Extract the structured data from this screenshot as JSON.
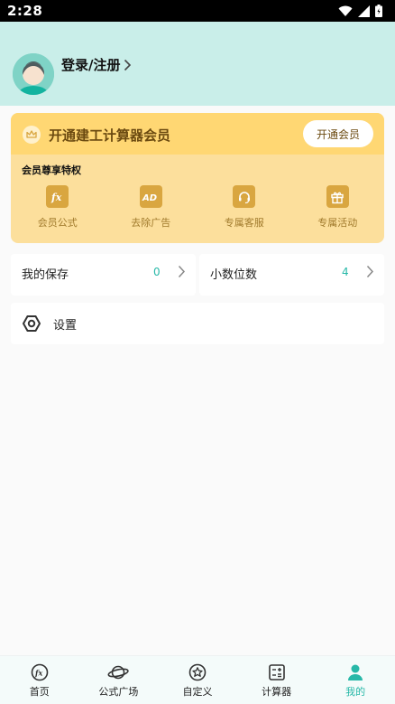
{
  "status_bar": {
    "time": "2:28"
  },
  "header": {
    "login_label": "登录/注册"
  },
  "vip": {
    "title": "开通建工计算器会员",
    "open_button": "开通会员",
    "subtitle": "会员尊享特权",
    "perks": [
      {
        "label": "会员公式",
        "icon": "fx-icon"
      },
      {
        "label": "去除广告",
        "icon": "ad-icon"
      },
      {
        "label": "专属客服",
        "icon": "headset-icon"
      },
      {
        "label": "专属活动",
        "icon": "gift-icon"
      }
    ]
  },
  "rows": {
    "saves": {
      "label": "我的保存",
      "count": "0"
    },
    "decimals": {
      "label": "小数位数",
      "count": "4"
    },
    "settings": {
      "label": "设置"
    }
  },
  "nav": {
    "items": [
      {
        "label": "首页",
        "icon": "fx-icon"
      },
      {
        "label": "公式广场",
        "icon": "planet-icon"
      },
      {
        "label": "自定义",
        "icon": "star-circle-icon"
      },
      {
        "label": "计算器",
        "icon": "calculator-icon"
      },
      {
        "label": "我的",
        "icon": "user-icon",
        "active": true
      }
    ]
  },
  "colors": {
    "accent": "#27b8a8",
    "header_bg": "#c9eee9",
    "vip_bg": "#fcdf9c",
    "vip_top": "#ffd773",
    "vip_text": "#6b4a10"
  }
}
